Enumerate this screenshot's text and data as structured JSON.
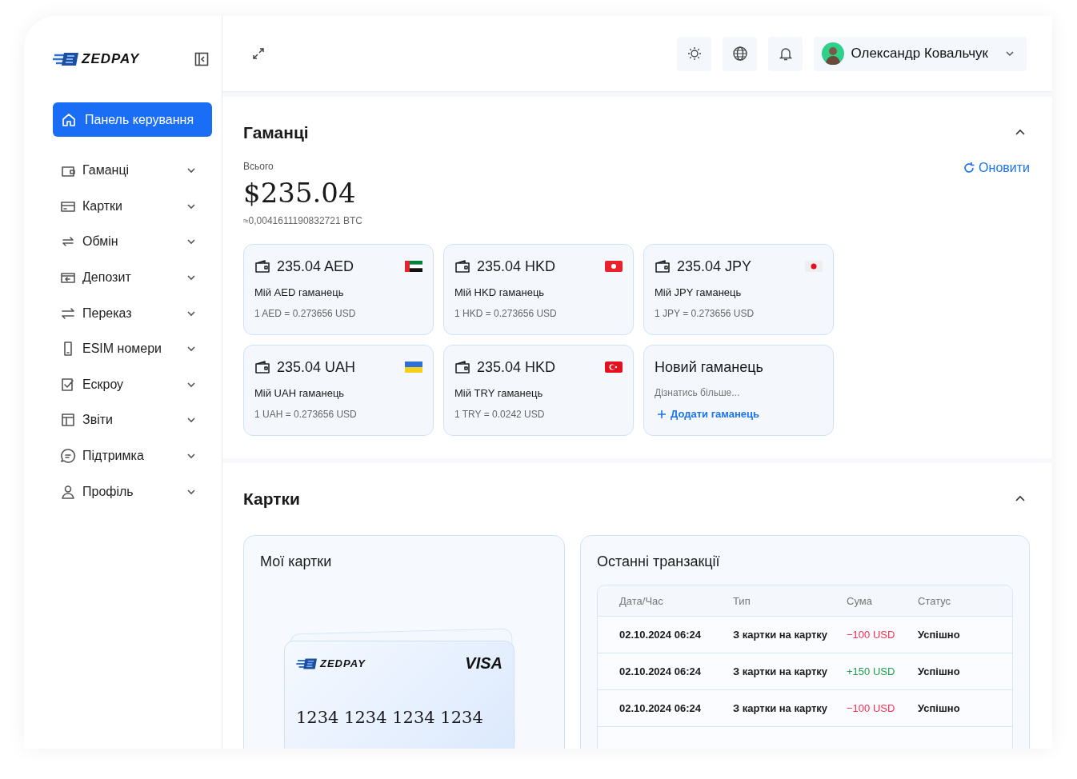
{
  "sidebar": {
    "logo": "ZEDPAY",
    "home": {
      "label": "Панель керування",
      "selected": true
    },
    "items": [
      {
        "label": "Гаманці",
        "expanded": false
      },
      {
        "label": "Картки",
        "expanded": false
      },
      {
        "label": "Обмін",
        "expanded": false
      },
      {
        "label": "Депозит",
        "expanded": false
      },
      {
        "label": "Переказ",
        "expanded": false
      },
      {
        "label": "ESIM номери",
        "expanded": false
      },
      {
        "label": "Ескроу",
        "expanded": false
      },
      {
        "label": "Звіти",
        "expanded": false
      },
      {
        "label": "Підтримка",
        "expanded": false
      },
      {
        "label": "Профіль",
        "expanded": false
      }
    ]
  },
  "header": {
    "user": "Олександр Ковальчук"
  },
  "wallets": {
    "title": "Гаманці",
    "expanded": true,
    "total_label": "Всього",
    "total": "$235.04",
    "btc": "≈0,0041611190832721 BTC",
    "refresh": "Оновити",
    "items": [
      {
        "kind": "ae",
        "amount": "235.04 AED",
        "name": "Мій AED гаманець",
        "rate": "1 AED = 0.273656 USD"
      },
      {
        "kind": "hk",
        "amount": "235.04 HKD",
        "name": "Мій HKD гаманець",
        "rate": "1 HKD = 0.273656 USD"
      },
      {
        "kind": "jp",
        "amount": "235.04 JPY",
        "name": "Мій JPY гаманець",
        "rate": "1 JPY = 0.273656 USD"
      },
      {
        "kind": "ua",
        "amount": "235.04 UAH",
        "name": "Мій UAH гаманець",
        "rate": "1 UAH = 0.273656 USD"
      },
      {
        "kind": "tr",
        "amount": "235.04 HKD",
        "name": "Мій TRY гаманець",
        "rate": "1 TRY = 0.0242 USD"
      },
      {
        "kind": "new",
        "amount": "Новий гаманець",
        "name": "Дізнатись більше...",
        "rate": "Додати гаманець"
      }
    ]
  },
  "cards": {
    "title": "Картки",
    "expanded": true,
    "my_cards": {
      "title": "Мої картки",
      "logo": "ZEDPAY",
      "network": "VISA",
      "number": "1234 1234 1234 1234"
    },
    "transactions": {
      "title": "Останні транзакції",
      "columns": [
        "Дата/Час",
        "Тип",
        "Сума",
        "Статус"
      ],
      "rows": [
        {
          "date": "02.10.2024 06:24",
          "type": "З картки на картку",
          "amount": "−100 USD",
          "kind": "debit",
          "status": "Успішно"
        },
        {
          "date": "02.10.2024 06:24",
          "type": "З картки на картку",
          "amount": "+150 USD",
          "kind": "credit",
          "status": "Успішно"
        },
        {
          "date": "02.10.2024 06:24",
          "type": "З картки на картку",
          "amount": "−100 USD",
          "kind": "debit",
          "status": "Успішно"
        }
      ]
    }
  }
}
